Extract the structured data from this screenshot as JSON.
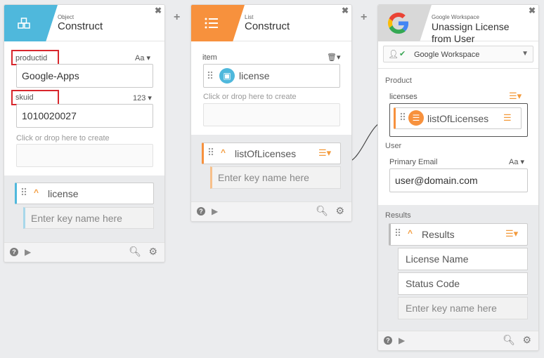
{
  "connectors": {
    "plus": "+"
  },
  "card1": {
    "type": "Object",
    "title": "Construct",
    "close": "✖",
    "fields": [
      {
        "label": "productid",
        "format": "Aa",
        "value": "Google-Apps"
      },
      {
        "label": "skuid",
        "format": "123",
        "value": "1010020027"
      }
    ],
    "drop_hint": "Click or drop here to create",
    "output": {
      "name": "license",
      "placeholder": "Enter key name here"
    }
  },
  "card2": {
    "type": "List",
    "title": "Construct",
    "close": "✖",
    "item_label": "item",
    "item_chip": "license",
    "drop_hint": "Click or drop here to create",
    "output": {
      "name": "listOfLicenses",
      "placeholder": "Enter key name here"
    }
  },
  "card3": {
    "type": "Google Workspace",
    "title_line1": "Unassign License",
    "title_line2": "from User",
    "close": "✖",
    "connection": "Google Workspace",
    "product_section": "Product",
    "licenses_label": "licenses",
    "licenses_chip": "listOfLicenses",
    "user_section": "User",
    "email_label": "Primary Email",
    "email_format": "Aa",
    "email_value": "user@domain.com",
    "results_section": "Results",
    "results": {
      "name": "Results",
      "fields": [
        "License Name",
        "Status Code"
      ],
      "placeholder": "Enter key name here"
    }
  },
  "footer": {
    "help": "?"
  }
}
